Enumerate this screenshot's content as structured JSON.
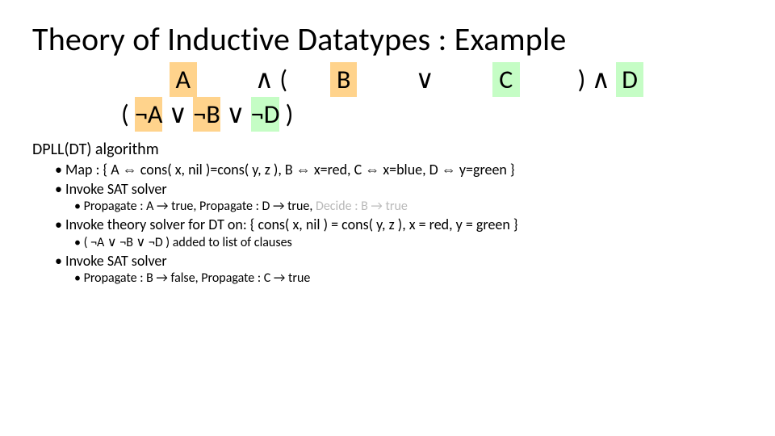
{
  "title": "Theory of Inductive Datatypes : Example",
  "formula": {
    "line1": {
      "A": "A",
      "and1": "∧",
      "lp": "(",
      "B": "B",
      "or": "∨",
      "C": "C",
      "rp": ")",
      "and2": "∧",
      "D": "D"
    },
    "line2": {
      "lp": "(",
      "nA": "¬A",
      "or1": "∨",
      "nB": "¬B",
      "or2": "∨",
      "nD": "¬D",
      "rp": ")"
    }
  },
  "section_heading": "DPLL(DT) algorithm",
  "bullets": {
    "map": "Map :  { A ⇔ cons( x, nil )=cons( y, z ), B ⇔ x=red, C ⇔ x=blue, D ⇔ y=green }",
    "invoke_sat_1": "Invoke SAT solver",
    "prop1_prefix": "Propagate : A → true, Propagate : D → true,  ",
    "prop1_grey": "Decide : B → true",
    "invoke_theory": "Invoke theory solver for DT on: { cons( x, nil ) = cons( y, z ), x = red, y = green }",
    "added_clause": "( ¬A ∨ ¬B ∨ ¬D ) added to list of clauses",
    "invoke_sat_2": "Invoke SAT solver",
    "prop2": "Propagate : B → false, Propagate : C → true"
  }
}
